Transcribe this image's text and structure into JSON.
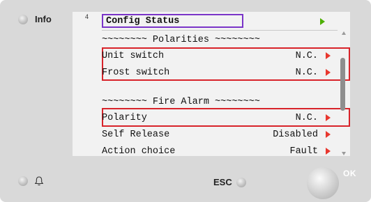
{
  "device": {
    "info_label": "Info",
    "esc_label": "ESC",
    "ok_label": "OK"
  },
  "screen": {
    "line_number": "4",
    "title": "Config Status",
    "sections": [
      {
        "header": "~~~~~~~~ Polarities ~~~~~~~~"
      },
      {
        "header": "~~~~~~~~ Fire Alarm ~~~~~~~~"
      }
    ],
    "rows": [
      {
        "label": "Unit switch",
        "value": "N.C."
      },
      {
        "label": "Frost switch",
        "value": "N.C."
      },
      {
        "label": "Polarity",
        "value": "N.C."
      },
      {
        "label": "Self Release",
        "value": "Disabled"
      },
      {
        "label": "Action choice",
        "value": "Fault"
      }
    ]
  },
  "colors": {
    "highlight_red": "#d8232a",
    "title_border_purple": "#7a34c8",
    "arrow_red": "#e8372e",
    "arrow_green": "#4caf00"
  },
  "icons": [
    "info-led-icon",
    "bell-icon",
    "esc-led-icon",
    "ok-knob-icon",
    "nav-arrow-icon"
  ]
}
